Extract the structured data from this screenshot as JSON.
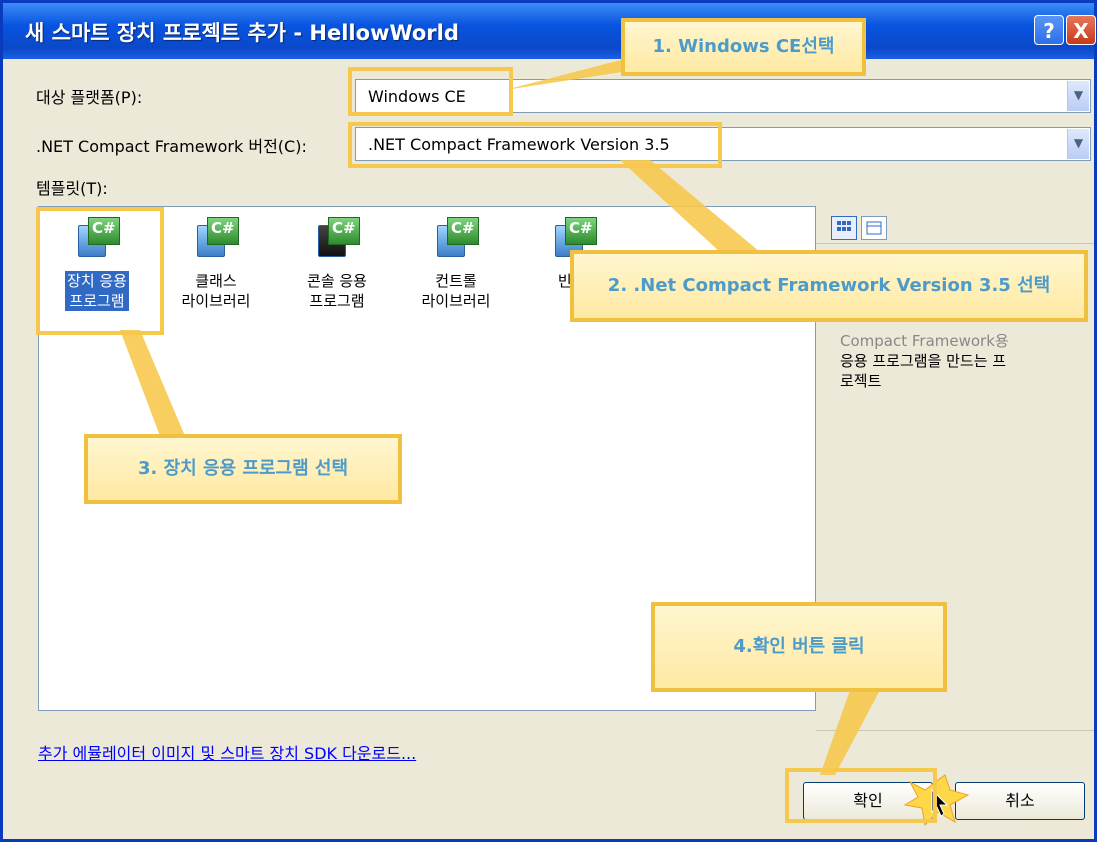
{
  "window": {
    "title": "새 스마트 장치 프로젝트 추가 - HellowWorld",
    "help_glyph": "?",
    "close_glyph": "X"
  },
  "form": {
    "platform_label": "대상 플랫폼(P):",
    "platform_value": "Windows CE",
    "framework_label": ".NET Compact Framework 버전(C):",
    "framework_value": ".NET Compact Framework Version 3.5",
    "templates_label": "템플릿(T):"
  },
  "templates": [
    {
      "line1": "장치 응용",
      "line2": "프로그램",
      "selected": true
    },
    {
      "line1": "클래스",
      "line2": "라이브러리",
      "selected": false
    },
    {
      "line1": "콘솔 응용",
      "line2": "프로그램",
      "selected": false
    },
    {
      "line1": "컨트롤",
      "line2": "라이브러리",
      "selected": false
    },
    {
      "line1": "빈 프",
      "line2": "",
      "selected": false
    }
  ],
  "description": {
    "line1": "Compact Framework용",
    "line2": "응용 프로그램을 만드는 프",
    "line3": "로젝트"
  },
  "link_text": "추가 에뮬레이터 이미지 및 스마트 장치 SDK 다운로드...",
  "buttons": {
    "ok": "확인",
    "cancel": "취소"
  },
  "callouts": {
    "c1": "1. Windows CE선택",
    "c2": "2. .Net Compact Framework Version 3.5 선택",
    "c3": "3. 장치 응용 프로그램 선택",
    "c4": "4.확인 버튼 클릭"
  },
  "colors": {
    "highlight": "#f6c94e",
    "callout_text": "#4d9bc9",
    "selection": "#316ac5",
    "titlebar": "#0854e0"
  }
}
